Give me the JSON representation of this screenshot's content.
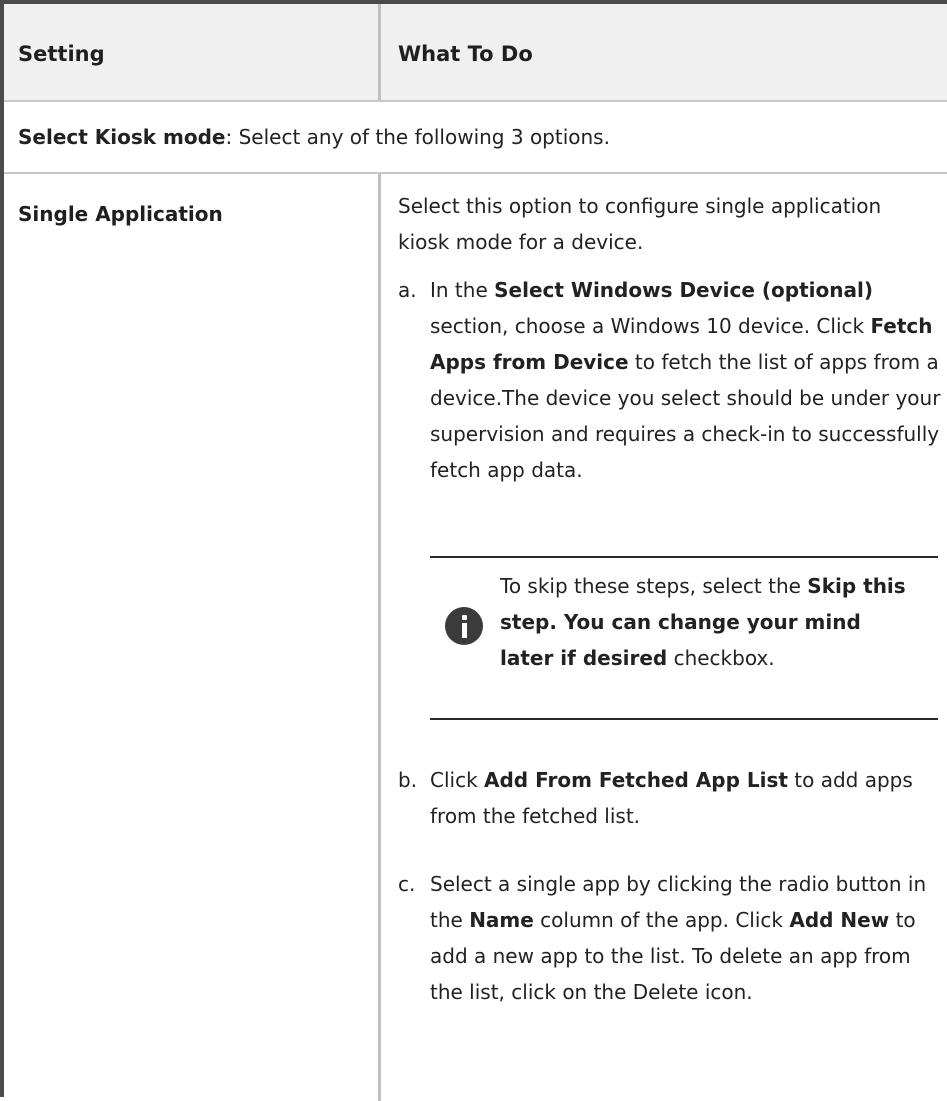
{
  "table": {
    "headers": [
      "Setting",
      "What To Do"
    ]
  },
  "kiosk_mode_row": {
    "label": "Select Kiosk mode",
    "text": ": Select any of the following 3 options."
  },
  "single_application": {
    "setting": "Single Application",
    "intro": "Select this option to configure single application kiosk mode for a device.",
    "steps": [
      {
        "marker": "a.",
        "parts": [
          {
            "t": "In the "
          },
          {
            "b": "Select Windows Device (optional)"
          },
          {
            "t": " section, choose a Windows 10 device. Click "
          },
          {
            "b": "Fetch Apps from Device"
          },
          {
            "t": " to fetch the list of apps from a device.The device you select should be under your supervision and requires a check-in to successfully fetch app data."
          }
        ]
      },
      {
        "marker": "b.",
        "parts": [
          {
            "t": "Click "
          },
          {
            "b": "Add From Fetched App List"
          },
          {
            "t": " to add apps from the fetched list."
          }
        ]
      },
      {
        "marker": "c.",
        "parts": [
          {
            "t": "Select a single app by clicking the radio button in the "
          },
          {
            "b": "Name"
          },
          {
            "t": " column of the app. Click "
          },
          {
            "b": "Add New"
          },
          {
            "t": " to add a new app to the list. To delete an app from the list, click on the Delete icon."
          }
        ]
      }
    ],
    "note": {
      "icon": "info-icon",
      "parts": [
        {
          "t": "To skip these steps, select the "
        },
        {
          "b": "Skip this step. You can change your mind later if desired"
        },
        {
          "t": " checkbox."
        }
      ]
    }
  }
}
